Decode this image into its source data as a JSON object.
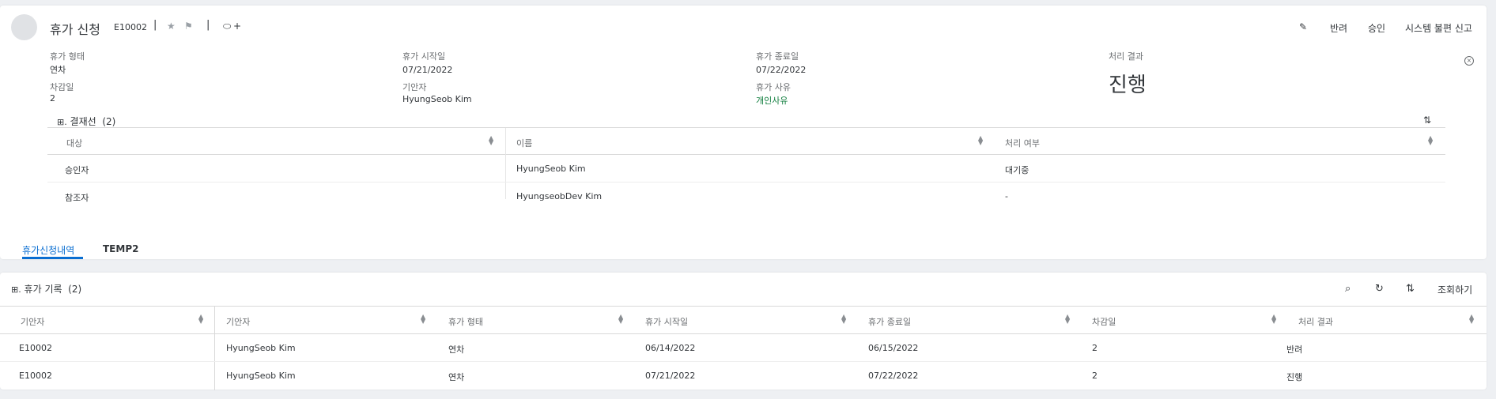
{
  "header": {
    "title": "휴가 신청",
    "id": "E10002",
    "separator": "|",
    "tag_plus": "+",
    "actions": {
      "reject": "반려",
      "approve": "승인",
      "report": "시스템 불편 신고"
    }
  },
  "fields": {
    "leave_type": {
      "label": "휴가 형태",
      "value": "연차"
    },
    "start_date": {
      "label": "휴가 시작일",
      "value": "07/21/2022"
    },
    "end_date": {
      "label": "휴가 종료일",
      "value": "07/22/2022"
    },
    "result": {
      "label": "처리 결과",
      "value": "진행"
    },
    "deduct_days": {
      "label": "차감일",
      "value": "2"
    },
    "drafter": {
      "label": "기안자",
      "value": "HyungSeob Kim"
    },
    "reason": {
      "label": "휴가 사유",
      "value": "개인사유"
    }
  },
  "approval": {
    "title": "결재선",
    "count": "(2)",
    "columns": [
      "대상",
      "이름",
      "처리 여부"
    ],
    "rows": [
      {
        "target": "승인자",
        "name": "HyungSeob Kim",
        "status": "대기중"
      },
      {
        "target": "참조자",
        "name": "HyungseobDev Kim",
        "status": "-"
      }
    ]
  },
  "tabs": [
    "휴가신청내역",
    "TEMP2"
  ],
  "records": {
    "title": "휴가 기록",
    "count": "(2)",
    "query_label": "조회하기",
    "columns": [
      "기안자",
      "기안자",
      "휴가 형태",
      "휴가 시작일",
      "휴가 종료일",
      "차감일",
      "처리 결과"
    ],
    "rows": [
      [
        "E10002",
        "HyungSeob Kim",
        "연차",
        "06/14/2022",
        "06/15/2022",
        "2",
        "반려"
      ],
      [
        "E10002",
        "HyungSeob Kim",
        "연차",
        "07/21/2022",
        "07/22/2022",
        "2",
        "진행"
      ]
    ]
  },
  "colors": {
    "accent": "#0a6ed1",
    "positive": "#107e3e",
    "background": "#eef0f3"
  },
  "icons": [
    "avatar",
    "star-icon",
    "flag-icon",
    "tag-icon",
    "pencil-icon",
    "close-circle-icon",
    "table-icon",
    "sort-icon",
    "search-icon",
    "refresh-icon"
  ]
}
